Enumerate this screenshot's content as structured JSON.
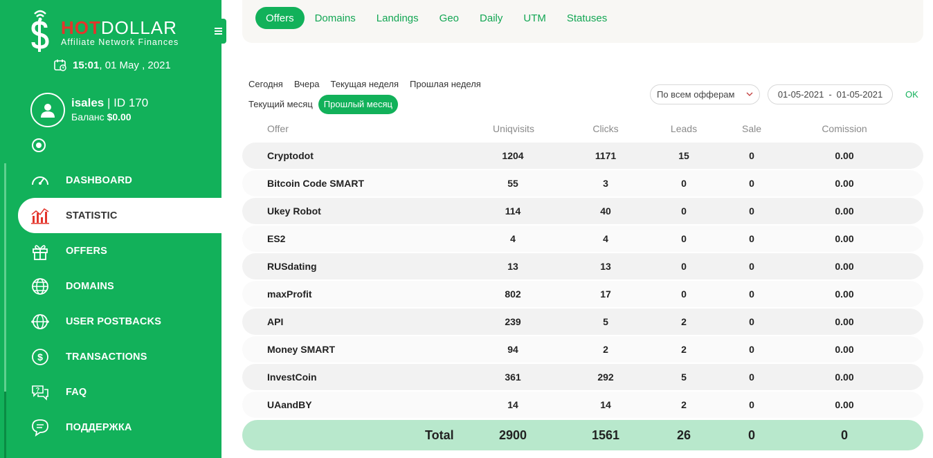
{
  "brand": {
    "name_hot": "HOT",
    "name_dollar": "DOLLAR",
    "tagline": "Affiliate Network Finances",
    "hot_color": "#e3352c",
    "accent_color": "#12b15a"
  },
  "datetime": {
    "time": "15:01",
    "date": ", 01 May , 2021"
  },
  "user": {
    "name": "isales",
    "id_label": " | ID 170",
    "balance_label": "Баланс ",
    "balance_value": "$0.00"
  },
  "nav": [
    {
      "label": "DASHBOARD",
      "icon": "speedometer-icon",
      "active": false
    },
    {
      "label": "STATISTIC",
      "icon": "bar-chart-icon",
      "active": true
    },
    {
      "label": "OFFERS",
      "icon": "gift-icon",
      "active": false
    },
    {
      "label": "DOMAINS",
      "icon": "globe-icon",
      "active": false
    },
    {
      "label": "USER POSTBACKS",
      "icon": "globe-network-icon",
      "active": false
    },
    {
      "label": "TRANSACTIONS",
      "icon": "dollar-coin-icon",
      "active": false
    },
    {
      "label": "FAQ",
      "icon": "chat-question-icon",
      "active": false
    },
    {
      "label": "ПОДДЕРЖКА",
      "icon": "chat-support-icon",
      "active": false
    }
  ],
  "tabs": [
    {
      "label": "Offers",
      "active": true
    },
    {
      "label": "Domains",
      "active": false
    },
    {
      "label": "Landings",
      "active": false
    },
    {
      "label": "Geo",
      "active": false
    },
    {
      "label": "Daily",
      "active": false
    },
    {
      "label": "UTM",
      "active": false
    },
    {
      "label": "Statuses",
      "active": false
    }
  ],
  "periods": {
    "row1": [
      "Сегодня",
      "Вчера",
      "Текущая неделя",
      "Прошлая неделя"
    ],
    "row2": [
      "Текущий месяц",
      "Прошлый месяц"
    ],
    "active": "Прошлый месяц"
  },
  "filters": {
    "offer_select": "По всем офферам",
    "date_from": "01-05-2021",
    "date_sep": "-",
    "date_to": "01-05-2021",
    "ok": "OK"
  },
  "table": {
    "headers": {
      "offer": "Offer",
      "uniq": "Uniqvisits",
      "clicks": "Clicks",
      "leads": "Leads",
      "sale": "Sale",
      "com": "Comission"
    },
    "rows": [
      {
        "offer": "Cryptodot",
        "uniq": "1204",
        "clicks": "1171",
        "leads": "15",
        "sale": "0",
        "com": "0.00"
      },
      {
        "offer": "Bitcoin Code SMART",
        "uniq": "55",
        "clicks": "3",
        "leads": "0",
        "sale": "0",
        "com": "0.00"
      },
      {
        "offer": "Ukey Robot",
        "uniq": "114",
        "clicks": "40",
        "leads": "0",
        "sale": "0",
        "com": "0.00"
      },
      {
        "offer": "ES2",
        "uniq": "4",
        "clicks": "4",
        "leads": "0",
        "sale": "0",
        "com": "0.00"
      },
      {
        "offer": "RUSdating",
        "uniq": "13",
        "clicks": "13",
        "leads": "0",
        "sale": "0",
        "com": "0.00"
      },
      {
        "offer": "maxProfit",
        "uniq": "802",
        "clicks": "17",
        "leads": "0",
        "sale": "0",
        "com": "0.00"
      },
      {
        "offer": "API",
        "uniq": "239",
        "clicks": "5",
        "leads": "2",
        "sale": "0",
        "com": "0.00"
      },
      {
        "offer": "Money SMART",
        "uniq": "94",
        "clicks": "2",
        "leads": "2",
        "sale": "0",
        "com": "0.00"
      },
      {
        "offer": "InvestCoin",
        "uniq": "361",
        "clicks": "292",
        "leads": "5",
        "sale": "0",
        "com": "0.00"
      },
      {
        "offer": "UAandBY",
        "uniq": "14",
        "clicks": "14",
        "leads": "2",
        "sale": "0",
        "com": "0.00"
      }
    ],
    "total": {
      "label": "Total",
      "uniq": "2900",
      "clicks": "1561",
      "leads": "26",
      "sale": "0",
      "com": "0"
    }
  }
}
